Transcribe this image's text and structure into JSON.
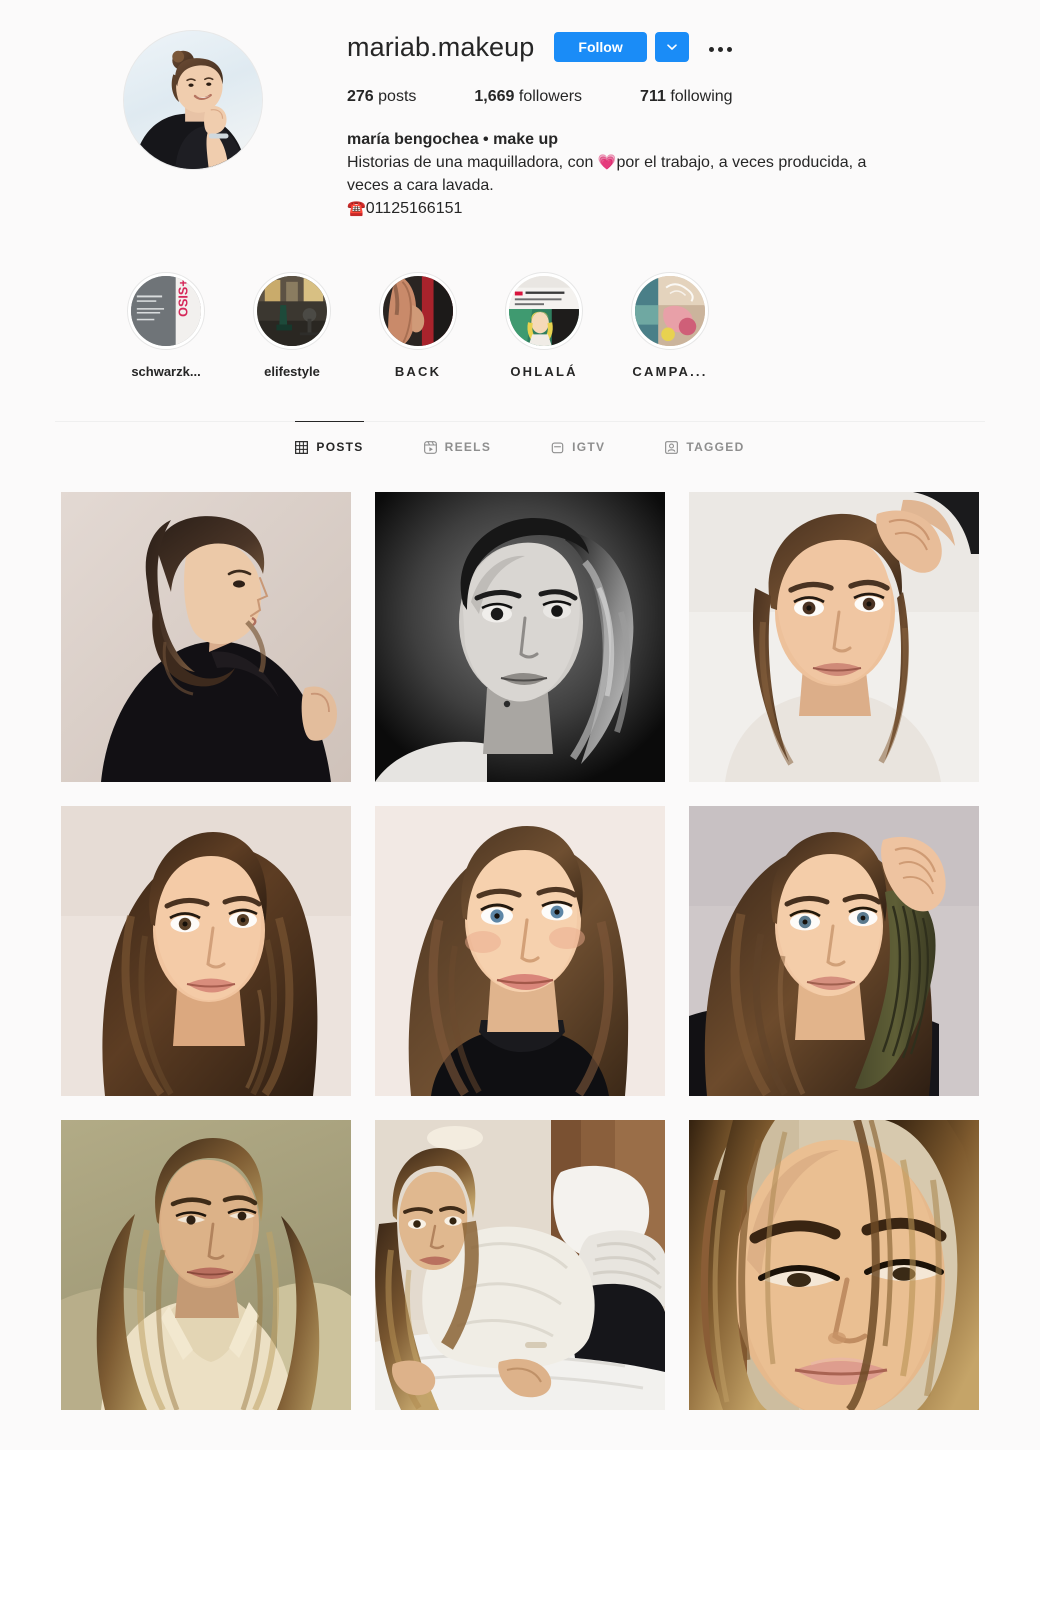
{
  "profile": {
    "username": "mariab.makeup",
    "avatar_alt": "profile-photo",
    "follow_label": "Follow",
    "dropdown_icon": "chevron-down-icon",
    "options_icon": "ellipsis-icon",
    "stats": [
      {
        "value": "276",
        "label": "posts"
      },
      {
        "value": "1,669",
        "label": "followers"
      },
      {
        "value": "711",
        "label": "following"
      }
    ],
    "bio": {
      "display_name": "maría bengochea • make up",
      "text_before_emoji": "Historias de una maquilladora, con ",
      "emoji": "💗",
      "text_after_emoji": "por el trabajo, a veces producida, a veces a cara lavada.",
      "phone_emoji": "☎️",
      "phone": "01125166151"
    }
  },
  "highlights": [
    {
      "label": "schwarzk...",
      "name": "highlight-schwarzkopf",
      "spaced": false
    },
    {
      "label": "elifestyle",
      "name": "highlight-elifestyle",
      "spaced": false
    },
    {
      "label": "BACK",
      "name": "highlight-back",
      "spaced": true
    },
    {
      "label": "OHLALÁ",
      "name": "highlight-ohlala",
      "spaced": true
    },
    {
      "label": "CAMPA...",
      "name": "highlight-campa",
      "spaced": true
    }
  ],
  "tabs": [
    {
      "label": "POSTS",
      "icon": "grid-icon",
      "active": true
    },
    {
      "label": "REELS",
      "icon": "reels-icon",
      "active": false
    },
    {
      "label": "IGTV",
      "icon": "igtv-icon",
      "active": false
    },
    {
      "label": "TAGGED",
      "icon": "tagged-icon",
      "active": false
    }
  ],
  "posts": [
    {
      "alt": "post-portrait-profile-black-top"
    },
    {
      "alt": "post-portrait-black-and-white"
    },
    {
      "alt": "post-portrait-hands-in-hair"
    },
    {
      "alt": "post-portrait-long-brown-hair"
    },
    {
      "alt": "post-portrait-black-turtleneck"
    },
    {
      "alt": "post-portrait-olive-sleeve"
    },
    {
      "alt": "post-portrait-cream-blouse"
    },
    {
      "alt": "post-portrait-on-bed"
    },
    {
      "alt": "post-portrait-closeup-looking-down"
    }
  ],
  "colors": {
    "accent_blue": "#1a8cf7",
    "text_primary": "#262626",
    "text_secondary": "#8e8e8e",
    "divider": "#efefef",
    "page_bg": "#fbfafa"
  }
}
